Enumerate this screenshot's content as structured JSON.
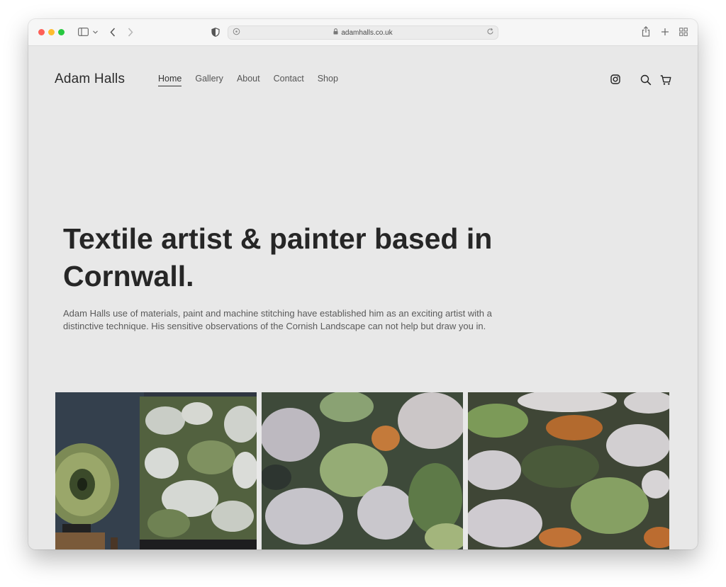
{
  "browser": {
    "url": "adamhalls.co.uk",
    "colors": {
      "close": "#fe5f57",
      "minimize": "#febc2e",
      "zoom": "#28c840"
    },
    "icons": [
      "sidebar-icon",
      "chevron-down-icon",
      "back-icon",
      "forward-icon",
      "shield-icon",
      "lock-icon",
      "reload-icon",
      "share-icon",
      "new-tab-icon",
      "tab-overview-icon"
    ]
  },
  "site": {
    "logo": "Adam Halls",
    "nav": [
      {
        "label": "Home",
        "active": true
      },
      {
        "label": "Gallery",
        "active": false
      },
      {
        "label": "About",
        "active": false
      },
      {
        "label": "Contact",
        "active": false
      },
      {
        "label": "Shop",
        "active": false
      }
    ],
    "icons": [
      "instagram-icon",
      "search-icon",
      "cart-icon"
    ],
    "hero": {
      "title": "Textile artist & painter based in Cornwall.",
      "text": "Adam Halls use of materials, paint and machine stitching have established him as an  exciting artist with a distinctive technique. His sensitive observations of the Cornish Landscape can not help but draw you in."
    },
    "gallery": [
      "gramophone-and-lichen-artwork",
      "lichen-textile-closeup",
      "lichen-textile-landscape"
    ]
  }
}
